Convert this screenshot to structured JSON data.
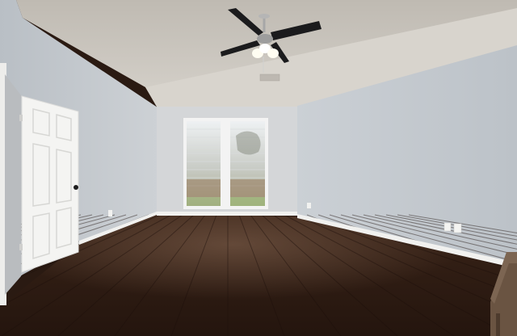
{
  "scene": {
    "subject": "empty-room-interior",
    "colors": {
      "ceiling": "#cdc8c0",
      "left_wall": "#c9ced3",
      "back_wall": "#d3d5d7",
      "right_wall": "#c4c9cf",
      "floor_dark": "#2b1a12",
      "floor_mid": "#4a2e1f",
      "baseboard": "#f2f2f0",
      "door": "#f4f4f2",
      "fan_blade": "#1b1b1d",
      "window_frame": "#f3f3f3"
    }
  }
}
